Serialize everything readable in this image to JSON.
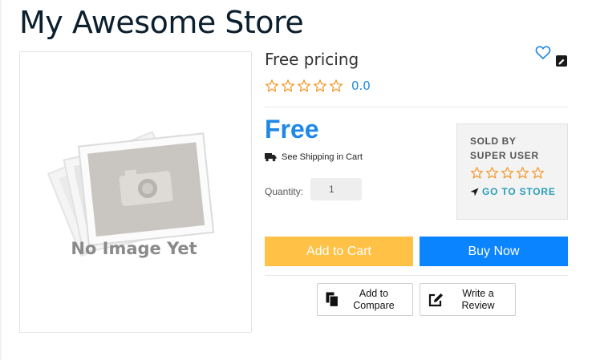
{
  "store": {
    "title": "My Awesome Store"
  },
  "product": {
    "image_placeholder_text": "No Image Yet",
    "name": "Free pricing",
    "rating": "0.0",
    "price": "Free",
    "shipping_text": "See Shipping in Cart",
    "quantity_label": "Quantity:",
    "quantity_value": "1"
  },
  "seller": {
    "sold_by_label": "SOLD BY",
    "name": "SUPER USER",
    "go_to_store_label": "GO TO STORE"
  },
  "actions": {
    "add_to_cart": "Add to Cart",
    "buy_now": "Buy Now",
    "add_to_compare": "Add to\nCompare",
    "write_review": "Write a\nReview"
  },
  "icons": {
    "wishlist": "heart-outline-icon",
    "edit": "pencil-icon",
    "shipping": "truck-icon",
    "go_to_store": "location-arrow-icon",
    "compare": "copy-icon",
    "review": "edit-square-icon",
    "star": "star-outline-icon"
  },
  "colors": {
    "accent_blue": "#1e88e5",
    "star_orange": "#f39c33",
    "add_to_cart_bg": "#ffc246",
    "buy_now_bg": "#0a84ff",
    "store_link": "#2a9db8"
  }
}
